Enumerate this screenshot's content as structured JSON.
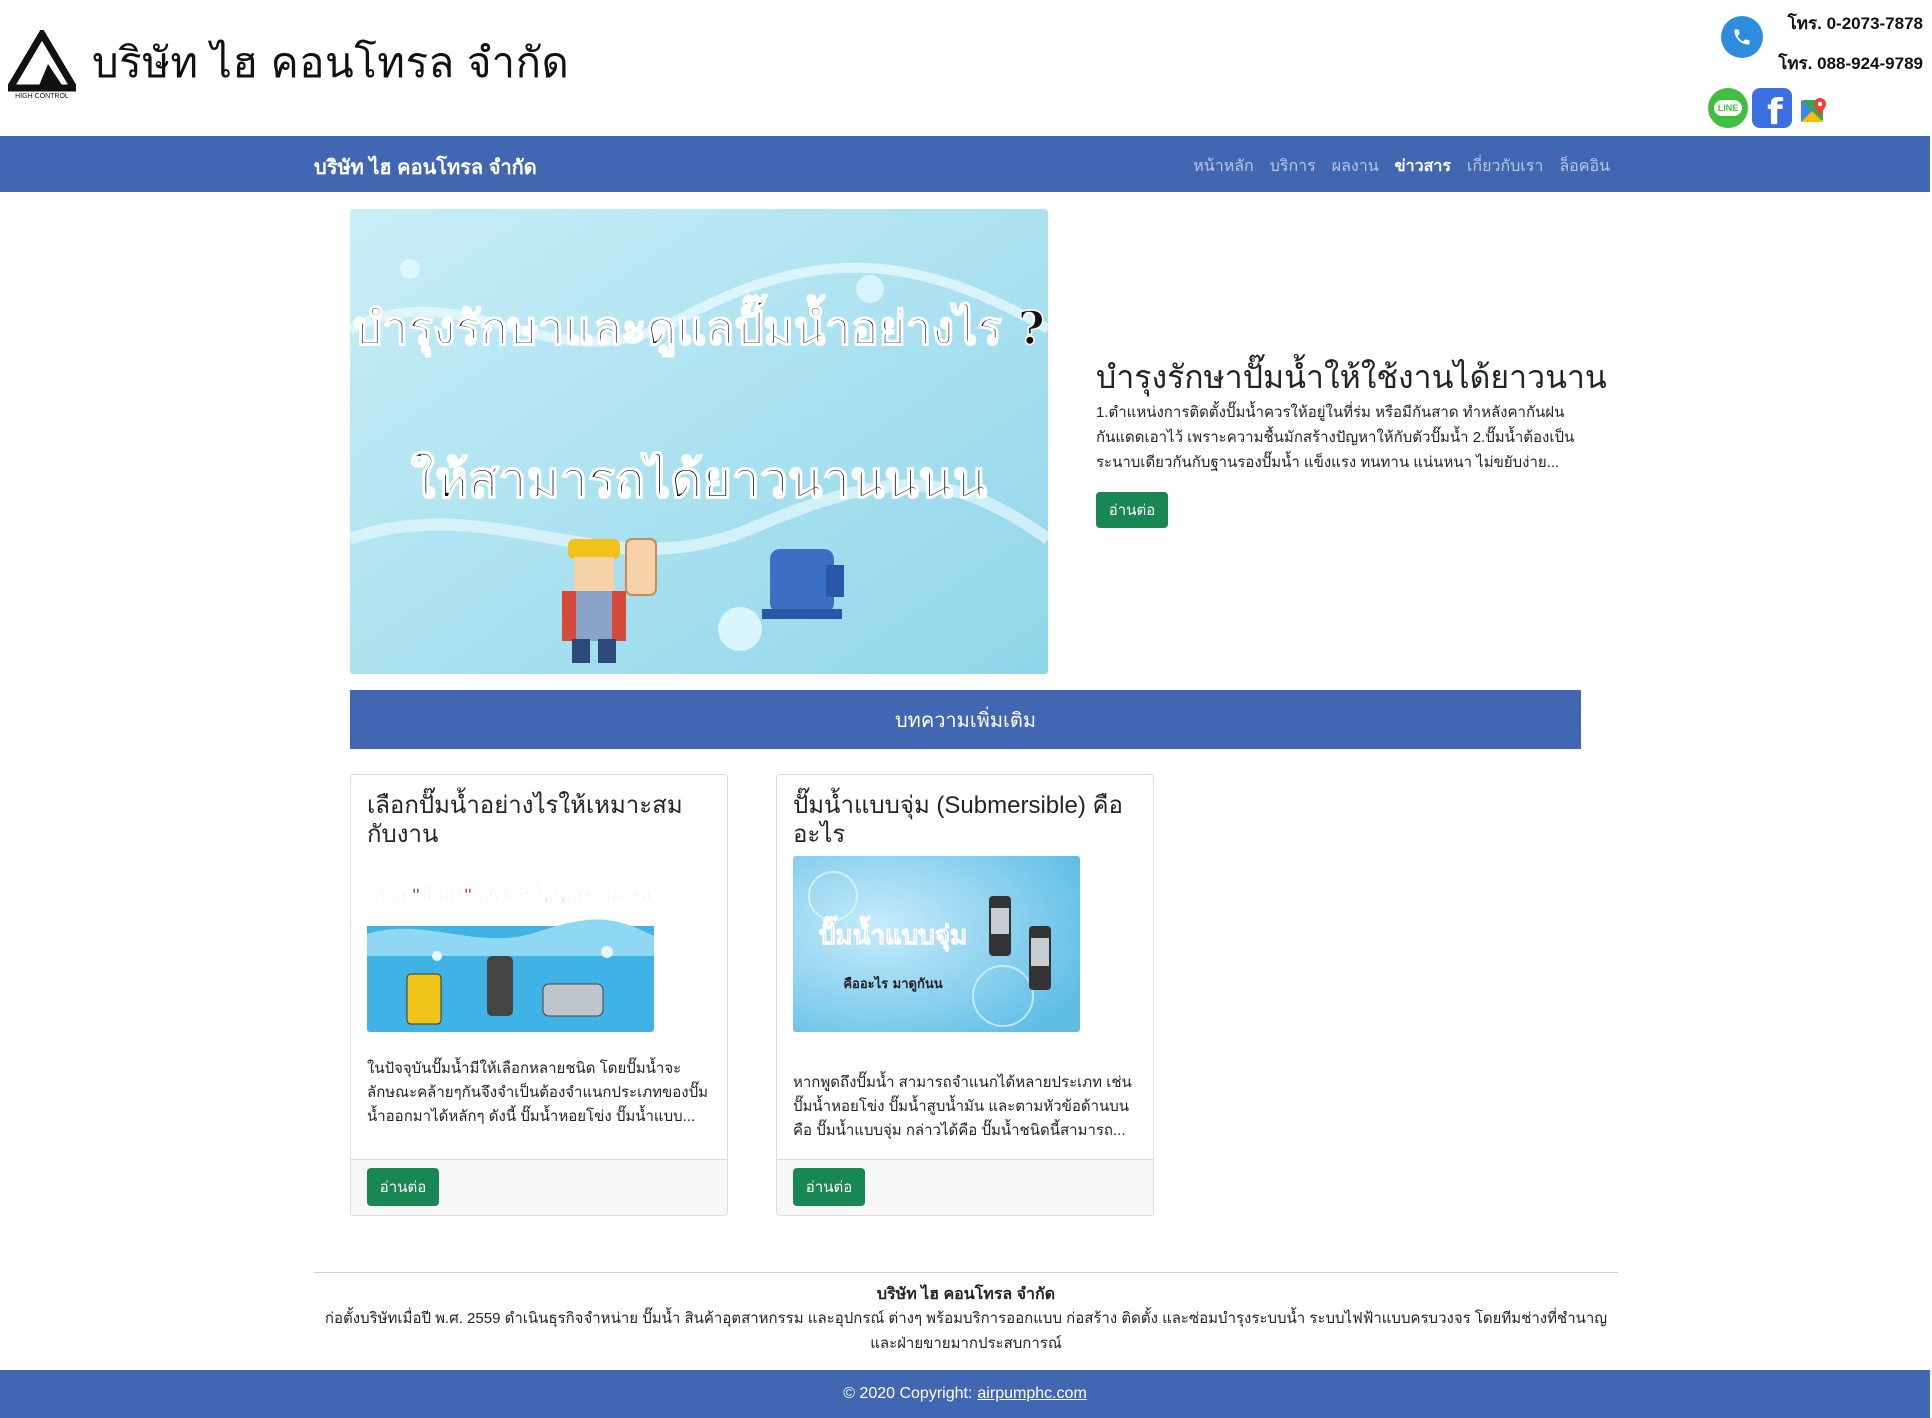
{
  "header": {
    "company_title": "บริษัท ไฮ  คอนโทรล จำกัด",
    "logo_caption": "HIGH CONTROL",
    "phone_1": "โทร. 0-2073-7878",
    "phone_2": "โทร. 088-924-9789",
    "social_line_label": "LINE",
    "social_facebook_glyph": "f",
    "icons": [
      "phone-icon",
      "line-icon",
      "facebook-icon",
      "map-icon"
    ]
  },
  "nav": {
    "brand": "บริษัท ไฮ  คอนโทรล จำกัด",
    "items": [
      {
        "label": "หน้าหลัก",
        "active": false
      },
      {
        "label": "บริการ",
        "active": false
      },
      {
        "label": "ผลงาน",
        "active": false
      },
      {
        "label": "ข่าวสาร",
        "active": true
      },
      {
        "label": "เกี่ยวกับเรา",
        "active": false
      },
      {
        "label": "ล็อคอิน",
        "active": false
      }
    ]
  },
  "hero": {
    "image_line_1": "บำรุงรักษาและดูแลปั๊มน้ำอย่างไร ?",
    "image_line_2": "ให้สามารถได้ยาวนานนนน",
    "title": "บำรุงรักษาปั๊มน้ำให้ใช้งานได้ยาวนาน",
    "excerpt": "1.ตำแหน่งการติดตั้งปั๊มน้ำควรให้อยู่ในที่ร่ม หรือมีกันสาด ทำหลังคากันฝน กันแดดเอาไว้ เพราะความชื้นมักสร้างปัญหาให้กับตัวปั๊มน้ำ 2.ปั๊มน้ำต้องเป็นระนาบเดียวกันกับฐานรองปั๊มน้ำ แข็งแรง ทนทาน แน่นหนา ไม่ขยับง่าย...",
    "button": "อ่านต่อ"
  },
  "section": {
    "title": "บทความเพิ่มเติม"
  },
  "cards": [
    {
      "title": "เลือกปั๊มน้ำอย่างไรให้เหมาะสมกับงาน",
      "image_text": "เลือก \"ปั๊มน้ำ\" อย่างไรให้เหมาะกับงาน",
      "excerpt": "ในปัจจุบันปั๊มน้ำมีให้เลือกหลายชนิด โดยปั๊มน้ำจะลักษณะคล้ายๆกันจึงจำเป็นต้องจำแนกประเภทของปั๊มน้ำออกมาได้หลักๆ ดังนี้ ปั๊มน้ำหอยโข่ง ปั๊มน้ำแบบ...",
      "button": "อ่านต่อ"
    },
    {
      "title": "ปั๊มน้ำแบบจุ่ม (Submersible) คืออะไร",
      "image_text": "ปั๊มน้ำแบบจุ่ม",
      "image_subtext": "คืออะไร  มาดูกันน",
      "excerpt": "หากพูดถึงปั๊มน้ำ สามารถจำแนกได้หลายประเภท เช่น ปั๊มน้ำหอยโข่ง ปั๊มน้ำสูบน้ำมัน และตามหัวข้อด้านบน คือ ปั๊มน้ำแบบจุ่ม กล่าวได้คือ ปั๊มน้ำชนิดนี้สามารถ...",
      "button": "อ่านต่อ"
    }
  ],
  "footer": {
    "company_name": "บริษัท ไฮ  คอนโทรล จำกัด",
    "description": "ก่อตั้งบริษัทเมื่อปี พ.ศ. 2559 ดำเนินธุรกิจจำหน่าย ปั๊มน้ำ สินค้าอุตสาหกรรม และอุปกรณ์ ต่างๆ พร้อมบริการออกแบบ ก่อสร้าง ติดตั้ง และซ่อมบำรุงระบบน้ำ ระบบไฟฟ้าแบบครบวงจร โดยทีมช่างที่ชำนาญและฝ่ายขายมากประสบการณ์",
    "copyright_prefix": "© 2020 Copyright:",
    "copyright_link": "airpumphc.com"
  },
  "colors": {
    "brand_blue": "#4267b2",
    "button_green": "#198754",
    "phone_blue": "#2f8ddf",
    "line_green": "#3fbf3f",
    "facebook_blue": "#3b6ee0"
  }
}
